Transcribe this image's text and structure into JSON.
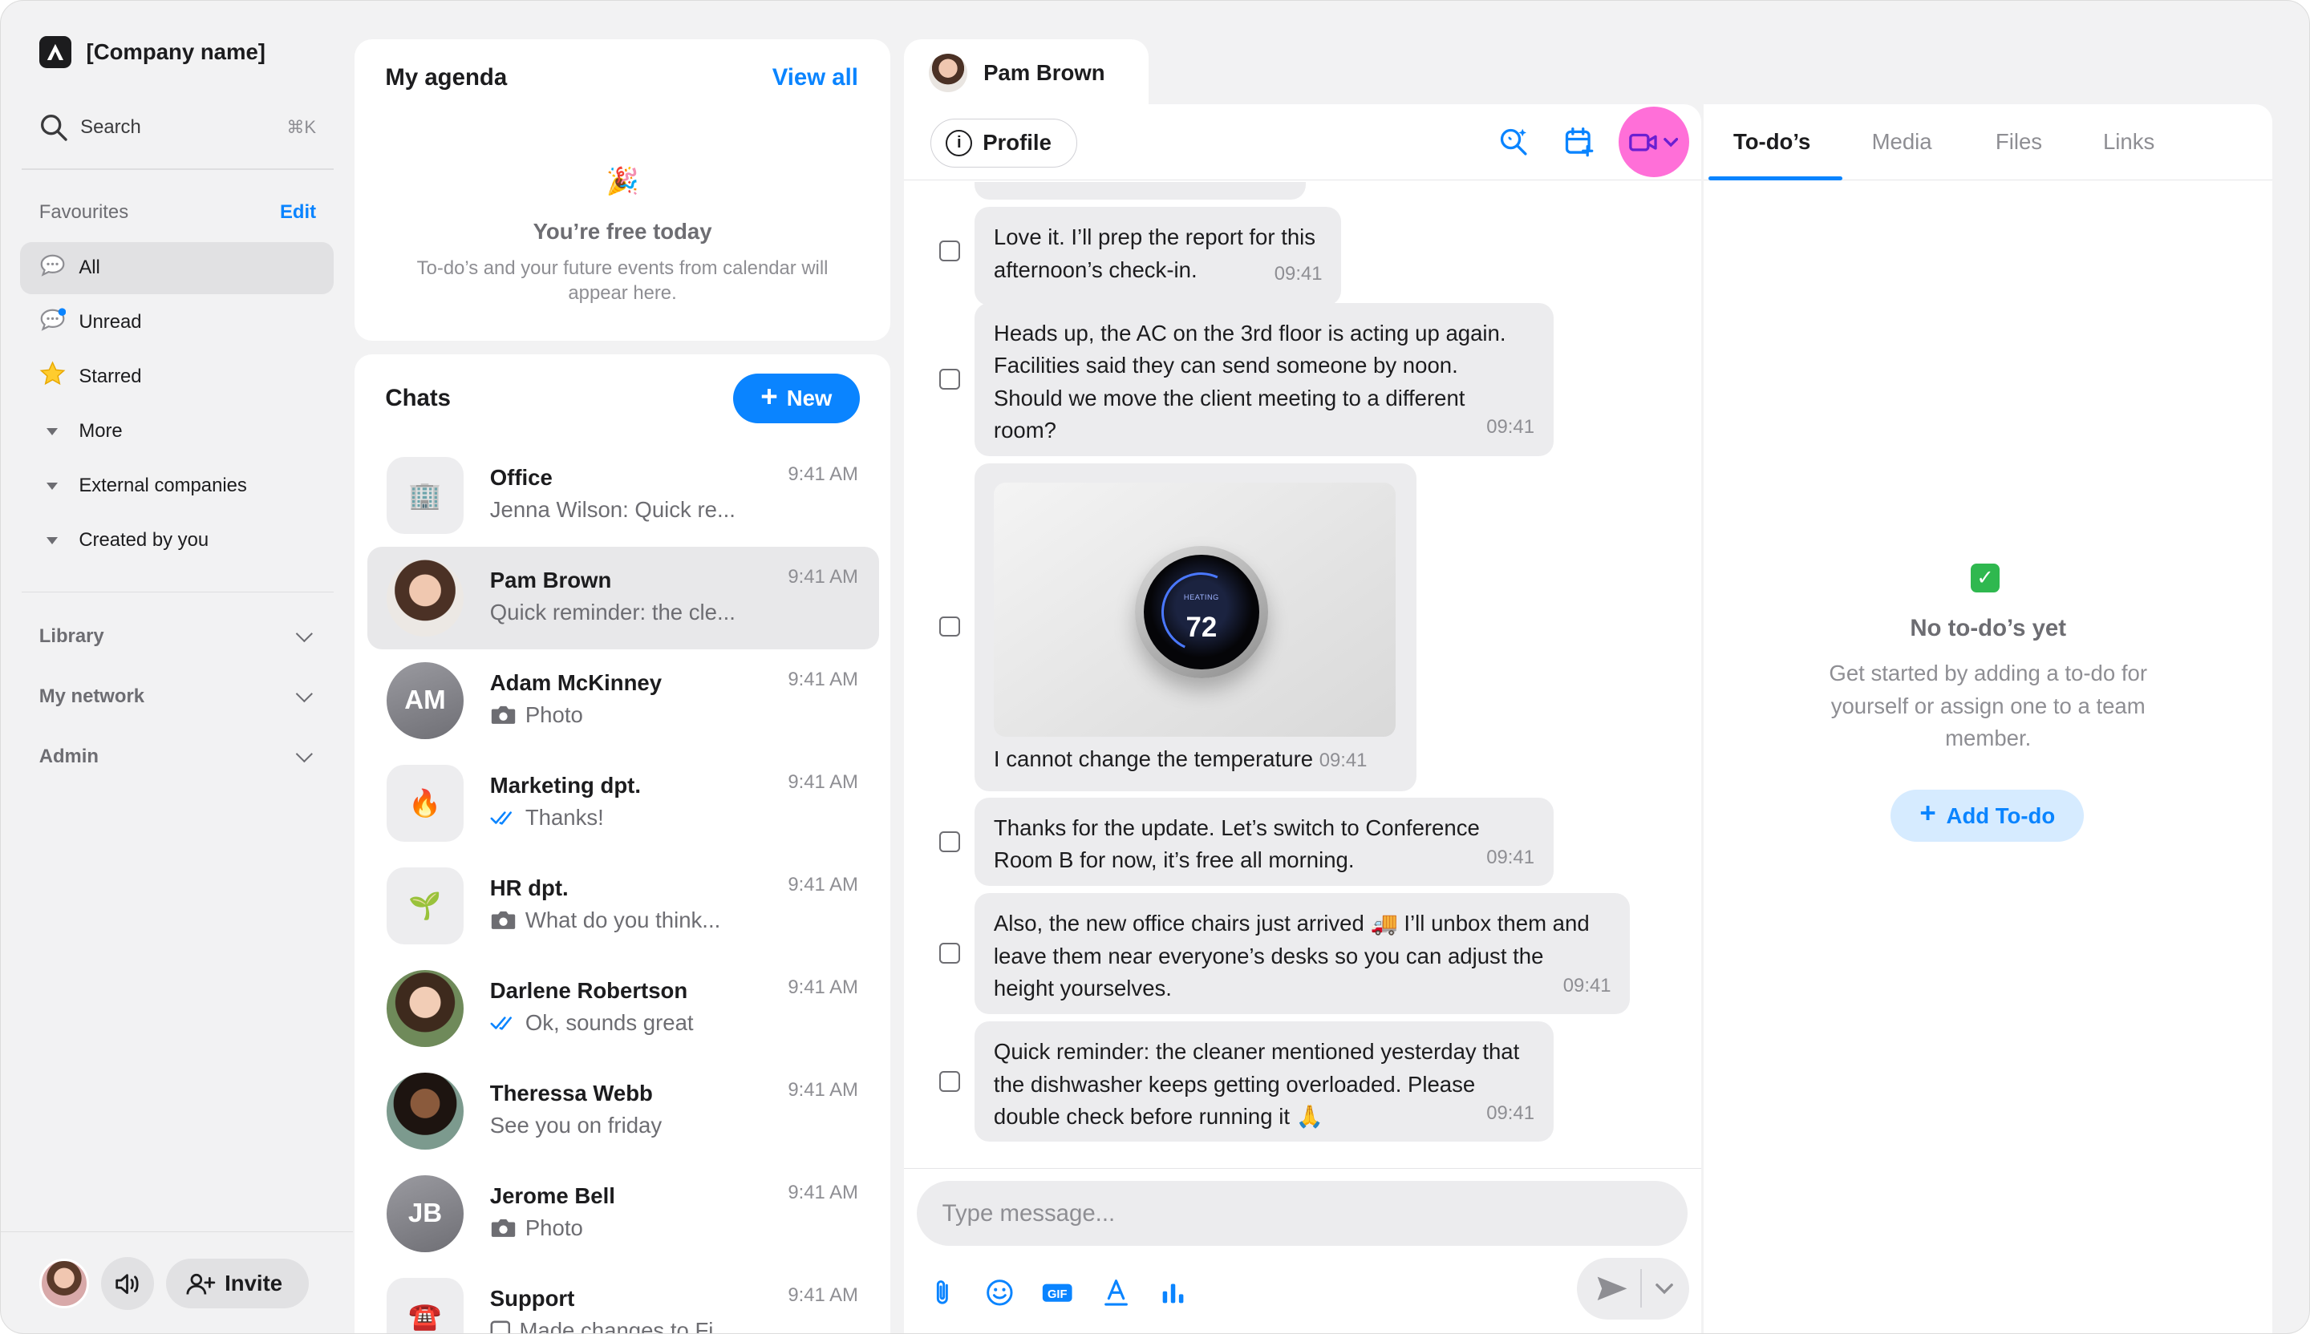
{
  "sidebar": {
    "company_name": "[Company name]",
    "search": {
      "label": "Search",
      "shortcut": "⌘K"
    },
    "favourites": {
      "title": "Favourites",
      "edit_label": "Edit"
    },
    "nav_items": [
      {
        "label": "All",
        "icon": "speech-bubble-icon"
      },
      {
        "label": "Unread",
        "icon": "speech-bubble-unread-icon"
      },
      {
        "label": "Starred",
        "icon": "star-icon"
      },
      {
        "label": "More",
        "icon": "caret-down-icon"
      },
      {
        "label": "External companies",
        "icon": "caret-down-icon"
      },
      {
        "label": "Created by you",
        "icon": "caret-down-icon"
      }
    ],
    "sections": [
      {
        "label": "Library"
      },
      {
        "label": "My network"
      },
      {
        "label": "Admin"
      }
    ],
    "invite_label": "Invite"
  },
  "agenda": {
    "title": "My agenda",
    "view_all_label": "View all",
    "emoji": "🎉",
    "free_title": "You’re free today",
    "description": "To-do’s and your future events from calendar will appear here."
  },
  "chats": {
    "title": "Chats",
    "new_label": "New",
    "items": [
      {
        "name": "Office",
        "time": "9:41 AM",
        "preview": "Jenna Wilson:  Quick re...",
        "avatar_type": "emoji",
        "avatar_emoji": "🏢",
        "preview_icon": ""
      },
      {
        "name": "Pam Brown",
        "time": "9:41 AM",
        "preview": "Quick reminder: the cle...",
        "avatar_type": "photo",
        "preview_icon": ""
      },
      {
        "name": "Adam McKinney",
        "time": "9:41 AM",
        "preview": "Photo",
        "avatar_type": "initials",
        "initials": "AM",
        "preview_icon": "camera-icon"
      },
      {
        "name": "Marketing dpt.",
        "time": "9:41 AM",
        "preview": "Thanks!",
        "avatar_type": "emoji",
        "avatar_emoji": "🔥",
        "preview_icon": "double-check-icon"
      },
      {
        "name": "HR dpt.",
        "time": "9:41 AM",
        "preview": "What do you think...",
        "avatar_type": "emoji",
        "avatar_emoji": "🌱",
        "preview_icon": "camera-icon"
      },
      {
        "name": "Darlene Robertson",
        "time": "9:41 AM",
        "preview": "Ok, sounds great",
        "avatar_type": "photo",
        "preview_icon": "double-check-icon"
      },
      {
        "name": "Theressa Webb",
        "time": "9:41 AM",
        "preview": "See you on friday",
        "avatar_type": "photo",
        "preview_icon": ""
      },
      {
        "name": "Jerome Bell",
        "time": "9:41 AM",
        "preview": "Photo",
        "avatar_type": "initials",
        "initials": "JB",
        "preview_icon": "camera-icon"
      },
      {
        "name": "Support",
        "time": "9:41 AM",
        "preview": "Made changes to Fi...",
        "avatar_type": "emoji",
        "avatar_emoji": "☎️",
        "preview_icon": "checkbox-icon"
      }
    ]
  },
  "conversation": {
    "contact_name": "Pam Brown",
    "profile_label": "Profile",
    "messages": [
      {
        "text": "Love it. I’ll prep the report for this afternoon’s check-in.",
        "time": "09:41"
      },
      {
        "text": "Heads up, the AC on the 3rd floor is acting up again. Facilities said they can send someone by noon. Should we move the client meeting to a different room?",
        "time": "09:41"
      },
      {
        "text": "I cannot change the temperature",
        "time": "09:41",
        "image": "thermostat-photo",
        "thermostat_label": "HEATING",
        "thermostat_value": "72"
      },
      {
        "text": "Thanks for the update. Let’s switch to Conference Room B for now, it’s free all morning.",
        "time": "09:41"
      },
      {
        "text": "Also, the new office chairs just arrived 🚚 I’ll unbox them and leave them near everyone’s desks so you can adjust the height yourselves.",
        "time": "09:41"
      },
      {
        "text": "Quick reminder: the cleaner mentioned yesterday that the dishwasher keeps getting overloaded. Please double check before running it 🙏",
        "time": "09:41"
      }
    ],
    "composer": {
      "placeholder": "Type message..."
    }
  },
  "right_panel": {
    "tabs": [
      {
        "label": "To-do’s",
        "active": true
      },
      {
        "label": "Media",
        "active": false
      },
      {
        "label": "Files",
        "active": false
      },
      {
        "label": "Links",
        "active": false
      }
    ],
    "empty_title": "No to-do’s yet",
    "empty_desc": "Get started by adding a to-do for yourself or assign one to a team member.",
    "add_label": "Add To-do"
  },
  "colors": {
    "accent": "#0a84ff",
    "video_highlight": "#ff6fd8",
    "bubble": "#ececee",
    "todo_check": "#2fb84f"
  }
}
